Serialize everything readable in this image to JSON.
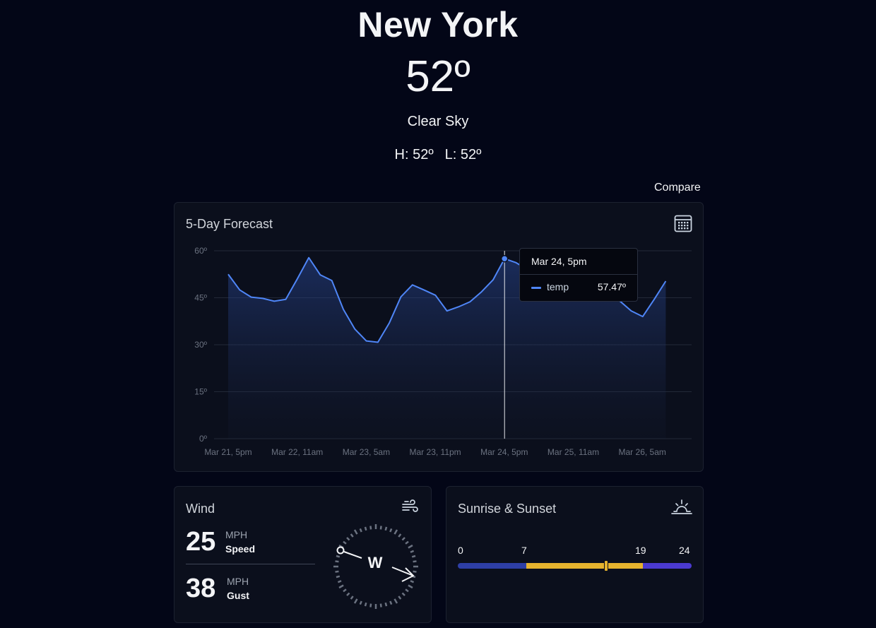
{
  "header": {
    "city": "New York",
    "temperature": "52º",
    "condition": "Clear Sky",
    "high": "H: 52º",
    "low": "L: 52º",
    "compare_label": "Compare"
  },
  "forecast": {
    "title": "5-Day Forecast",
    "icon": "calendar-icon",
    "tooltip": {
      "title": "Mar 24, 5pm",
      "series_name": "temp",
      "value": "57.47º"
    }
  },
  "chart_data": {
    "type": "area",
    "series": [
      {
        "name": "temp",
        "color": "#4f86f7",
        "values": [
          52.5,
          47.5,
          45.2,
          44.8,
          43.9,
          44.5,
          51.0,
          57.8,
          52.3,
          50.5,
          41.3,
          35.0,
          31.2,
          30.8,
          37.0,
          45.3,
          49.1,
          47.5,
          45.8,
          40.8,
          42.1,
          43.7,
          46.9,
          50.7,
          57.47,
          56.2,
          54.0,
          53.0,
          52.0,
          51.0,
          50.0,
          49.0,
          48.0,
          47.0,
          44.0,
          40.8,
          39.0,
          44.5,
          50.3
        ]
      }
    ],
    "x_tick_labels": [
      "Mar 21, 5pm",
      "Mar 22, 11am",
      "Mar 23, 5am",
      "Mar 23, 11pm",
      "Mar 24, 5pm",
      "Mar 25, 11am",
      "Mar 26, 5am"
    ],
    "y_tick_labels": [
      "60º",
      "45º",
      "30º",
      "15º",
      "0º"
    ],
    "ylim": [
      0,
      60
    ],
    "grid": true,
    "highlight_index": 24
  },
  "wind": {
    "title": "Wind",
    "icon": "wind-icon",
    "speed_value": "25",
    "speed_unit": "MPH",
    "speed_label": "Speed",
    "gust_value": "38",
    "gust_unit": "MPH",
    "gust_label": "Gust",
    "direction": "W"
  },
  "sun": {
    "title": "Sunrise & Sunset",
    "icon": "sunrise-icon",
    "ticks": [
      "0",
      "7",
      "19",
      "24"
    ],
    "sunrise_hour": 7,
    "sunset_hour": 19,
    "current_hour": 15.2,
    "night_color": "#2e3fa6",
    "day_color": "#e6b32e",
    "evening_color": "#4b3ad0"
  }
}
